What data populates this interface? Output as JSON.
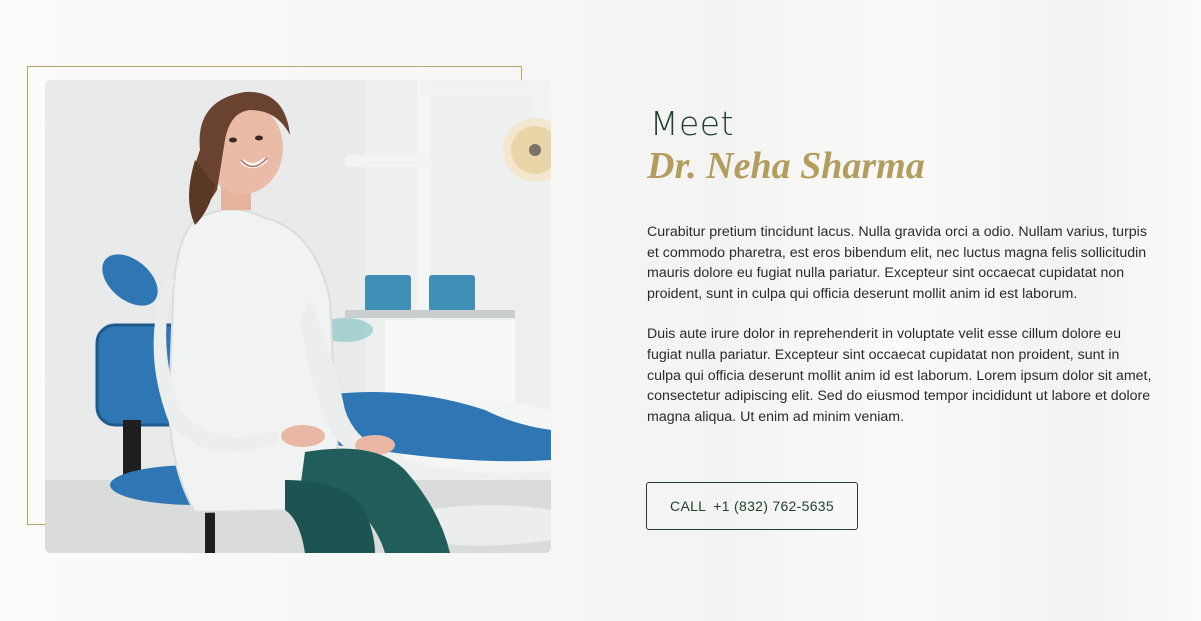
{
  "about": {
    "heading_line1": "Meet",
    "heading_line2": "Dr. Neha Sharma",
    "paragraphs": [
      "Curabitur pretium tincidunt lacus. Nulla gravida orci a odio. Nullam varius, turpis et commodo pharetra, est eros bibendum elit, nec luctus magna felis sollicitudin mauris dolore eu fugiat nulla pariatur. Excepteur sint occaecat cupidatat non proident, sunt in culpa qui officia deserunt mollit anim id est laborum.",
      "Duis aute irure dolor in reprehenderit in voluptate velit esse cillum dolore eu fugiat nulla pariatur. Excepteur sint occaecat cupidatat non proident, sunt in culpa qui officia deserunt mollit anim id est laborum. Lorem ipsum dolor sit amet, consectetur adipiscing elit. Sed do eiusmod tempor incididunt ut labore et dolore magna aliqua. Ut enim ad minim veniam."
    ],
    "call_button": {
      "label": "CALL",
      "phone": "+1 (832) 762-5635"
    }
  },
  "colors": {
    "brand_green": "#21402f",
    "accent_gold": "#b29d5f",
    "frame_gold": "#b8a56a"
  },
  "photo": {
    "subject": "dentist-portrait-in-clinic"
  }
}
